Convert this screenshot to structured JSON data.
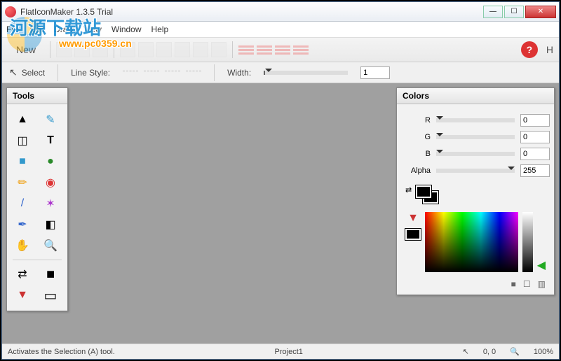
{
  "title": "FlatIconMaker 1.3.5 Trial",
  "menu": {
    "file": "File",
    "edit": "Edit",
    "draw": "Draw",
    "view": "View",
    "window": "Window",
    "help": "Help"
  },
  "toolbar": {
    "new": "New",
    "help_glyph": "?",
    "h_label": "H"
  },
  "linebar": {
    "select": "Select",
    "linestyle": "Line Style:",
    "width": "Width:",
    "width_value": "1"
  },
  "tools_title": "Tools",
  "colors": {
    "title": "Colors",
    "r_label": "R",
    "r_value": "0",
    "g_label": "G",
    "g_value": "0",
    "b_label": "B",
    "b_value": "0",
    "alpha_label": "Alpha",
    "alpha_value": "255"
  },
  "status": {
    "hint": "Activates the Selection (A) tool.",
    "project": "Project1",
    "coords": "0, 0",
    "zoom": "100%"
  },
  "watermark": {
    "text1": "河源下载站",
    "text2": "www.pc0359.cn"
  },
  "tool_icons": {
    "select": "▲",
    "eyedrop": "✎",
    "crop": "◫",
    "text": "T",
    "rect": "■",
    "circle": "●",
    "pencil": "✏",
    "target": "◉",
    "brush": "/",
    "wand": "✶",
    "pen": "✒",
    "erase": "◧",
    "hand": "✋",
    "zoom": "🔍",
    "swap": "⇄",
    "fg": "■",
    "grad": "▼",
    "stroke": "▭"
  }
}
